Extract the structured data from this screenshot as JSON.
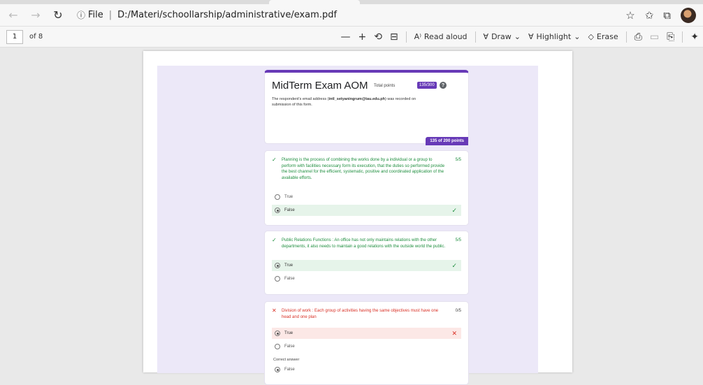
{
  "browser": {
    "url_prefix": "File",
    "url": "D:/Materi/schoollarship/administrative/exam.pdf",
    "nav": {
      "back": "←",
      "forward": "→",
      "refresh": "↻",
      "info": "ⓘ"
    },
    "right_icons": {
      "favorite": "☆",
      "favorites": "✩",
      "collections": "⧉"
    }
  },
  "pdf_toolbar": {
    "page_current": "1",
    "page_total": "of 8",
    "zoom_out": "—",
    "zoom_in": "+",
    "read_aloud": "Read aloud",
    "draw": "Draw",
    "highlight": "Highlight",
    "erase": "Erase"
  },
  "form": {
    "title": "MidTerm Exam AOM",
    "total_points_label": "Total points",
    "total_points_value": "135/300",
    "email_note_prefix": "The respondent's email address (",
    "email": "intl_setyaningrum@tau.edu.ph",
    "email_note_suffix": ") was recorded on submission of this form.",
    "section_score": "135 of 200 points",
    "questions": [
      {
        "text": "Planning is the process of combining the works done by a individual or a group to perform with facilities necessary form its execution, that the duties so performed provide the best channel for the efficient, systematic, positive and coordinated application of the available efforts.",
        "points": "5/5",
        "options": [
          "True",
          "False"
        ]
      },
      {
        "text": "Public Relations Functions : An office has not only maintains relations with the other departments, it also needs to maintain a good relations with the outside world the public.",
        "points": "5/5",
        "options": [
          "True",
          "False"
        ]
      },
      {
        "text": "Division of work : Each group of activities having the same objectives must have one head and one plan",
        "points": "0/5",
        "options": [
          "True",
          "False"
        ],
        "correct_label": "Correct answer",
        "correct_answer": "False"
      }
    ]
  },
  "colors": {
    "accent": "#673ab7",
    "correct": "#1e8e3e",
    "incorrect": "#d93025"
  }
}
